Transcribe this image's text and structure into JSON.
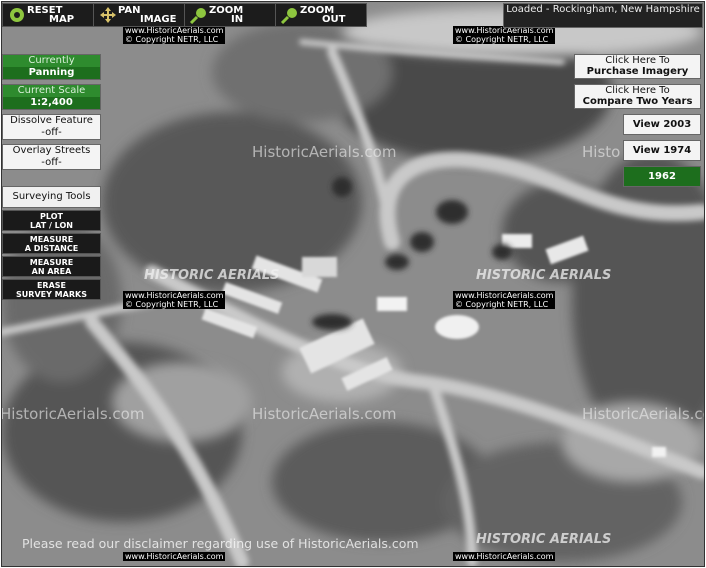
{
  "toolbar": {
    "reset": {
      "top": "RESET",
      "bottom": "MAP"
    },
    "pan": {
      "top": "PAN",
      "bottom": "IMAGE"
    },
    "zoom_in": {
      "top": "ZOOM",
      "bottom": "IN"
    },
    "zoom_out": {
      "top": "ZOOM",
      "bottom": "OUT"
    }
  },
  "loaded_text": "Loaded - Rockingham, New Hampshire",
  "left_panel": {
    "mode": {
      "label": "Currently",
      "value": "Panning"
    },
    "scale": {
      "label": "Current Scale",
      "value": "1:2,400"
    },
    "dissolve": {
      "label": "Dissolve Feature",
      "value": "-off-"
    },
    "streets": {
      "label": "Overlay Streets",
      "value": "-off-"
    },
    "surveying_title": "Surveying Tools",
    "tools": [
      {
        "line1": "PLOT",
        "line2": "LAT / LON"
      },
      {
        "line1": "MEASURE",
        "line2": "A DISTANCE"
      },
      {
        "line1": "MEASURE",
        "line2": "AN AREA"
      },
      {
        "line1": "ERASE",
        "line2": "SURVEY MARKS"
      }
    ]
  },
  "right_panel": {
    "purchase": {
      "line1": "Click Here To",
      "line2": "Purchase Imagery"
    },
    "compare": {
      "line1": "Click Here To",
      "line2": "Compare Two Years"
    },
    "years": [
      "View 2003",
      "View 1974",
      "1962"
    ]
  },
  "watermark": {
    "url_line": "www.HistoricAerials.com",
    "copyright_line": "© Copyright NETR, LLC",
    "site_text": "HistoricAerials.com",
    "site_partial": "Histo",
    "logo_text": "HISTORIC AERIALS"
  },
  "disclaimer": "Please read our disclaimer regarding use of HistoricAerials.com",
  "colors": {
    "accent_green": "#1d6e1d",
    "toolbar_dark": "#1c1c1c"
  }
}
